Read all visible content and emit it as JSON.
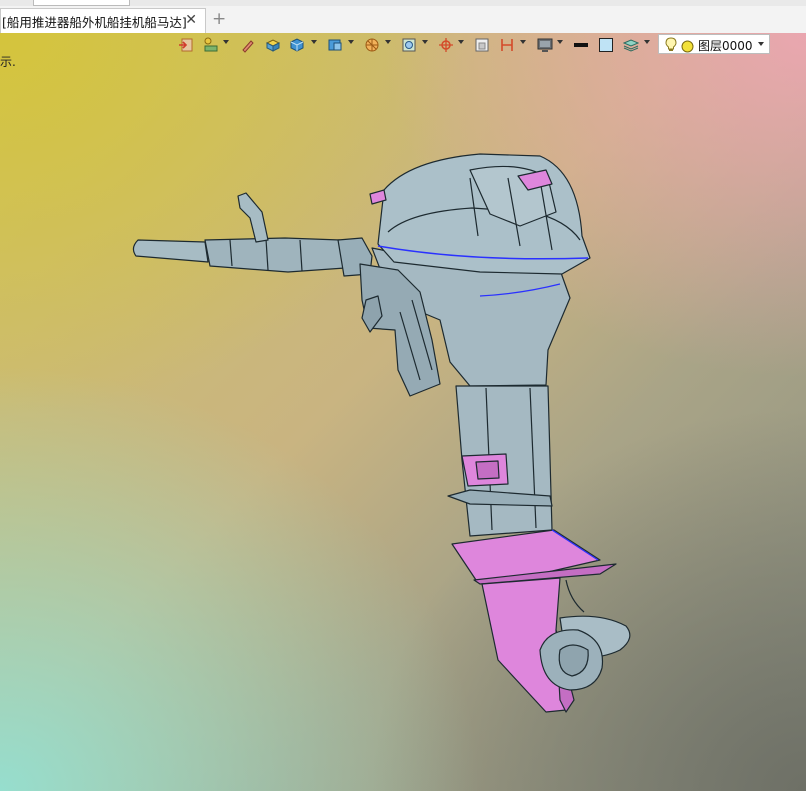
{
  "document": {
    "tab_title": "[船用推进器船外机船挂机船马达]",
    "close_glyph": "✕",
    "add_tab_glyph": "+"
  },
  "toolbar": {
    "icons": [
      "exit-icon",
      "layer-tree-icon",
      "pen-icon",
      "solid-shade-icon",
      "cube-icon",
      "view-cube-icon",
      "globe-render-icon",
      "zoom-fit-icon",
      "crosshair-pan-icon",
      "frame-icon",
      "section-icon",
      "monitor-icon",
      "line-color-swatch",
      "fill-color-swatch",
      "stack-layers-icon"
    ],
    "layer": {
      "name": "图层0000",
      "light_icon": "lightbulb-icon",
      "state_icon": "yellow-circle-icon"
    }
  },
  "viewport": {
    "hint_text": "示."
  },
  "colors": {
    "model_body": "#a9bcc4",
    "model_edge": "#1d2a30",
    "highlight": "#de86dc",
    "accent_edge": "#2a31ff"
  }
}
